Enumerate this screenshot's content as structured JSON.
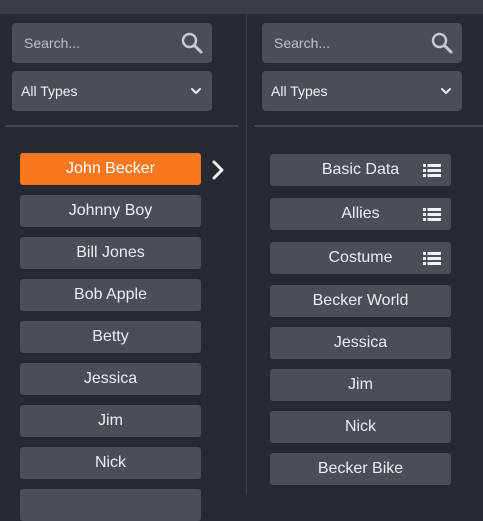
{
  "left_panel": {
    "search": {
      "placeholder": "Search..."
    },
    "type_filter": {
      "selected": "All Types"
    },
    "items": [
      {
        "label": "John Becker",
        "selected": true
      },
      {
        "label": "Johnny Boy"
      },
      {
        "label": "Bill Jones"
      },
      {
        "label": "Bob Apple"
      },
      {
        "label": "Betty"
      },
      {
        "label": "Jessica"
      },
      {
        "label": "Jim"
      },
      {
        "label": "Nick"
      },
      {
        "label": ""
      }
    ]
  },
  "right_panel": {
    "search": {
      "placeholder": "Search..."
    },
    "type_filter": {
      "selected": "All Types"
    },
    "items": [
      {
        "label": "Basic Data",
        "icon": "list-icon"
      },
      {
        "label": "Allies",
        "icon": "list-icon"
      },
      {
        "label": "Costume",
        "icon": "list-icon"
      },
      {
        "label": "Becker World"
      },
      {
        "label": "Jessica"
      },
      {
        "label": "Jim"
      },
      {
        "label": "Nick"
      },
      {
        "label": "Becker Bike"
      }
    ]
  },
  "colors": {
    "background": "#252a33",
    "control": "#4a4e56",
    "accent": "#f7781d"
  }
}
